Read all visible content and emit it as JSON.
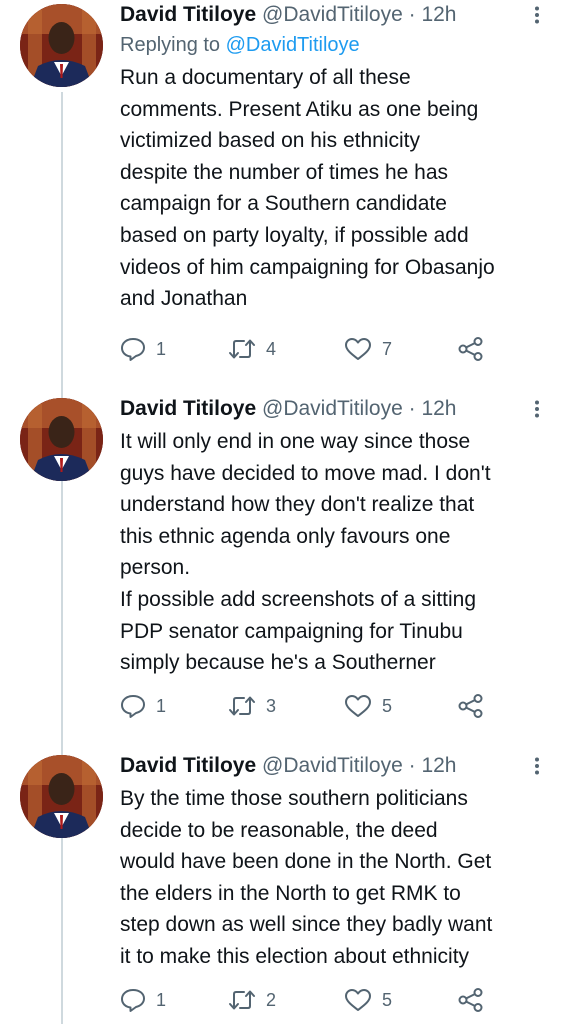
{
  "tweets": [
    {
      "name": "David Titiloye",
      "handle": "@DavidTitiloye",
      "dot": "·",
      "time": "12h",
      "replying_prefix": "Replying to",
      "replying_to": "@DavidTitiloye",
      "lines": [
        "Run a documentary of all these",
        "comments. Present Atiku as one being",
        "victimized based on his ethnicity",
        "despite the number of times he has",
        "campaign for a Southern candidate",
        "based on party loyalty, if possible add",
        "videos of him campaigning for Obasanjo",
        "and Jonathan"
      ],
      "replies": "1",
      "retweets": "4",
      "likes": "7"
    },
    {
      "name": "David Titiloye",
      "handle": "@DavidTitiloye",
      "dot": "·",
      "time": "12h",
      "lines": [
        "It will only end in one way since those",
        "guys have decided to move mad. I don't",
        "understand how they don't realize that",
        "this ethnic agenda only favours one",
        "person.",
        "If possible add screenshots of a sitting",
        "PDP senator campaigning for Tinubu",
        "simply because he's a Southerner"
      ],
      "replies": "1",
      "retweets": "3",
      "likes": "5"
    },
    {
      "name": "David Titiloye",
      "handle": "@DavidTitiloye",
      "dot": "·",
      "time": "12h",
      "lines": [
        "By the time those southern politicians",
        "decide to be reasonable, the deed",
        "would have been done in the North. Get",
        "the elders in the North to get RMK to",
        "step down as well since they badly want",
        "it to make this election about ethnicity"
      ],
      "replies": "1",
      "retweets": "2",
      "likes": "5"
    }
  ],
  "icons": {
    "reply": "reply-icon",
    "retweet": "retweet-icon",
    "like": "like-icon",
    "share": "share-icon",
    "more": "more-vertical-icon"
  },
  "colors": {
    "text": "#0f1419",
    "muted": "#536471",
    "link": "#1d9bf0",
    "thread_line": "#cfd9de"
  }
}
